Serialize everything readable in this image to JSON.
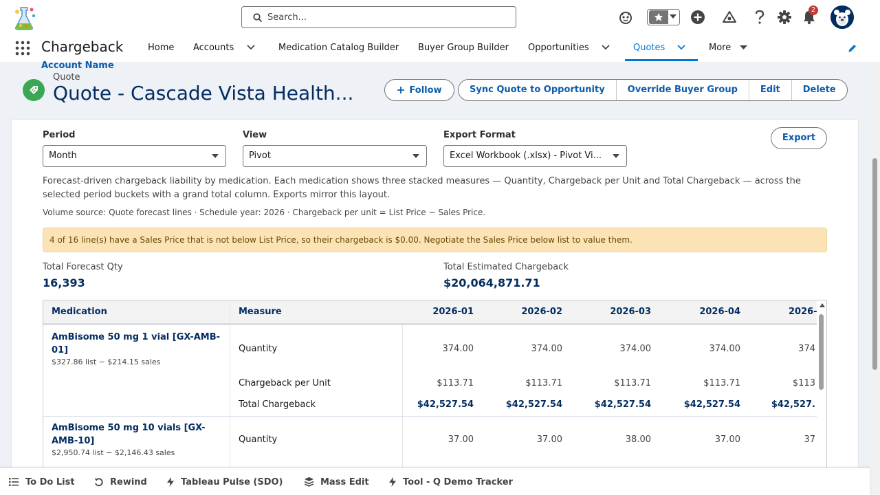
{
  "header": {
    "search_placeholder": "Search...",
    "notification_count": "2"
  },
  "nav": {
    "app_name": "Chargeback",
    "items": [
      {
        "label": "Home"
      },
      {
        "label": "Accounts"
      },
      {
        "label": "Medication Catalog Builder"
      },
      {
        "label": "Buyer Group Builder"
      },
      {
        "label": "Opportunities"
      },
      {
        "label": "Quotes",
        "active": true
      },
      {
        "label": "More"
      }
    ]
  },
  "record": {
    "object_label": "Quote",
    "title": "Quote - Cascade Vista Health...",
    "partial_text_above": "Account Name"
  },
  "actions": {
    "follow": "Follow",
    "buttons": [
      "Sync Quote to Opportunity",
      "Override Buyer Group",
      "Edit",
      "Delete"
    ]
  },
  "controls": {
    "period_label": "Period",
    "period_value": "Month",
    "view_label": "View",
    "view_value": "Pivot",
    "export_format_label": "Export Format",
    "export_format_value": "Excel Workbook (.xlsx) - Pivot Vi...",
    "export_button": "Export"
  },
  "description": "Forecast-driven chargeback liability by medication. Each medication shows three stacked measures — Quantity, Chargeback per Unit and Total Chargeback — across the selected period buckets with a grand total column. Exports mirror this layout.",
  "meta": "Volume source: Quote forecast lines · Schedule year: 2026 · Chargeback per unit = List Price − Sales Price.",
  "warning": "4 of 16 line(s) have a Sales Price that is not below List Price, so their chargeback is $0.00. Negotiate the Sales Price below list to value them.",
  "stats": {
    "qty_label": "Total Forecast Qty",
    "qty_value": "16,393",
    "chargeback_label": "Total Estimated Chargeback",
    "chargeback_value": "$20,064,871.71"
  },
  "table": {
    "headers": {
      "medication": "Medication",
      "measure": "Measure",
      "periods": [
        "2026-01",
        "2026-02",
        "2026-03",
        "2026-04",
        "2026-"
      ]
    },
    "measure_labels": [
      "Quantity",
      "Chargeback per Unit",
      "Total Chargeback"
    ],
    "rows": [
      {
        "name": "AmBisome 50 mg 1 vial [GX-AMB-01]",
        "price_note": "$327.86 list − $214.15 sales",
        "quantity": [
          "374.00",
          "374.00",
          "374.00",
          "374.00",
          "374"
        ],
        "per_unit": [
          "$113.71",
          "$113.71",
          "$113.71",
          "$113.71",
          "$113"
        ],
        "total": [
          "$42,527.54",
          "$42,527.54",
          "$42,527.54",
          "$42,527.54",
          "$42,527."
        ]
      },
      {
        "name": "AmBisome 50 mg 10 vials [GX-AMB-10]",
        "price_note": "$2,950.74 list − $2,146.43 sales",
        "quantity": [
          "37.00",
          "37.00",
          "38.00",
          "37.00",
          "37"
        ]
      }
    ]
  },
  "utility_bar": [
    {
      "label": "To Do List",
      "icon": "list-icon"
    },
    {
      "label": "Rewind",
      "icon": "rewind-icon"
    },
    {
      "label": "Tableau Pulse (SDO)",
      "icon": "bolt-icon"
    },
    {
      "label": "Mass Edit",
      "icon": "stack-icon"
    },
    {
      "label": "Tool - Q Demo Tracker",
      "icon": "bolt-icon"
    }
  ]
}
